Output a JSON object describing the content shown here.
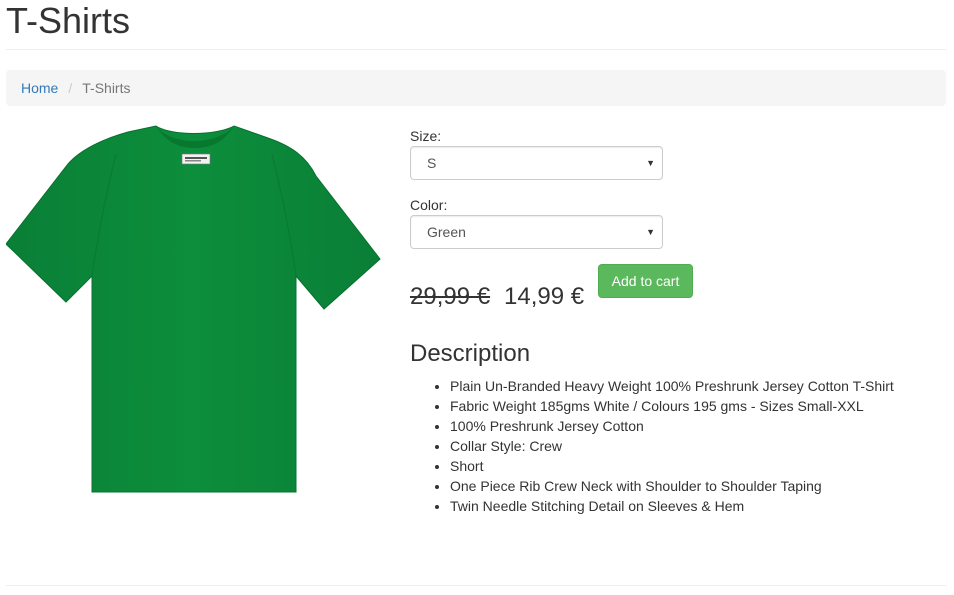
{
  "page": {
    "title": "T-Shirts"
  },
  "breadcrumb": {
    "home": "Home",
    "separator": "/",
    "current": "T-Shirts"
  },
  "product": {
    "image_icon": "green-tshirt-image",
    "image_color": "#0b8a3a",
    "size": {
      "label": "Size:",
      "selected": "S"
    },
    "color": {
      "label": "Color:",
      "selected": "Green"
    },
    "price_old": "29,99 €",
    "price_new": "14,99 €",
    "add_to_cart": "Add to cart",
    "button_color": "#5cb85c"
  },
  "description": {
    "title": "Description",
    "items": [
      "Plain Un-Branded Heavy Weight 100% Preshrunk Jersey Cotton T-Shirt",
      "Fabric Weight 185gms White / Colours 195 gms - Sizes Small-XXL",
      "100% Preshrunk Jersey Cotton",
      "Collar Style: Crew",
      "Short",
      "One Piece Rib Crew Neck with Shoulder to Shoulder Taping",
      "Twin Needle Stitching Detail on Sleeves & Hem"
    ]
  }
}
